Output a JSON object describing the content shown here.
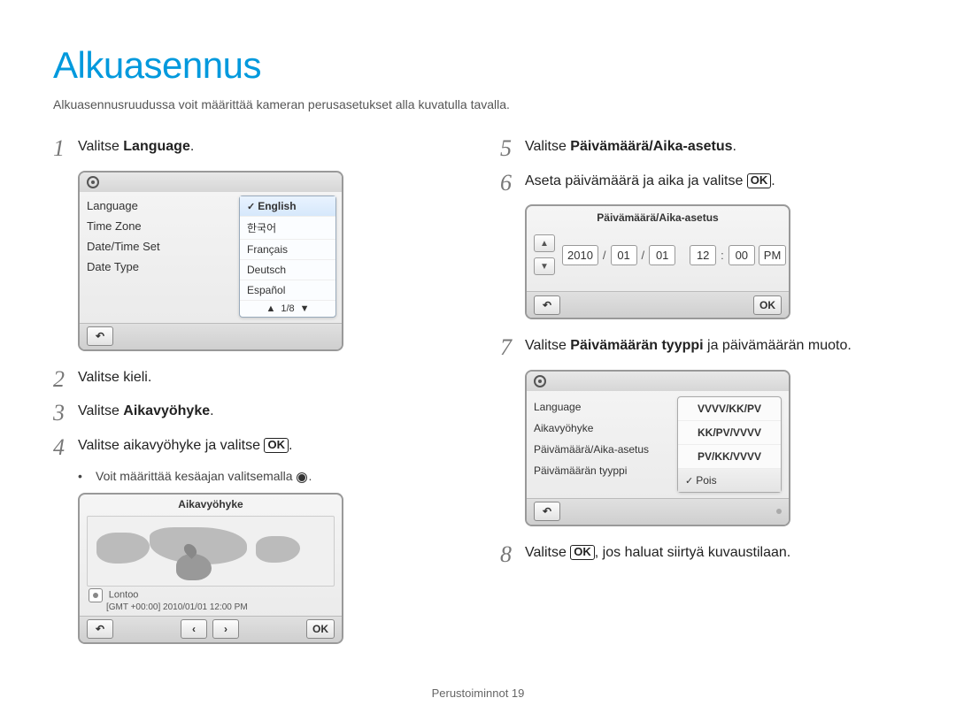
{
  "title": "Alkuasennus",
  "intro": "Alkuasennusruudussa voit määrittää kameran perusasetukset alla kuvatulla tavalla.",
  "steps": {
    "s1": {
      "num": "1",
      "prefix": "Valitse ",
      "bold": "Language",
      "suffix": "."
    },
    "s2": {
      "num": "2",
      "text": "Valitse kieli."
    },
    "s3": {
      "num": "3",
      "prefix": "Valitse ",
      "bold": "Aikavyöhyke",
      "suffix": "."
    },
    "s4": {
      "num": "4",
      "text_a": "Valitse aikavyöhyke ja valitse ",
      "text_b": "."
    },
    "s4_bullet": "Voit määrittää kesäajan valitsemalla ",
    "s5": {
      "num": "5",
      "prefix": "Valitse ",
      "bold": "Päivämäärä/Aika-asetus",
      "suffix": "."
    },
    "s6": {
      "num": "6",
      "text_a": "Aseta päivämäärä ja aika ja valitse ",
      "text_b": "."
    },
    "s7": {
      "num": "7",
      "prefix": "Valitse ",
      "bold": "Päivämäärän tyyppi",
      "suffix": " ja päivämäärän muoto."
    },
    "s8": {
      "num": "8",
      "text_a": "Valitse ",
      "text_b": ", jos haluat siirtyä kuvaustilaan."
    }
  },
  "lang_panel": {
    "menu": [
      "Language",
      "Time Zone",
      "Date/Time Set",
      "Date Type"
    ],
    "opts": [
      "English",
      "한국어",
      "Français",
      "Deutsch",
      "Español"
    ],
    "pager": "1/8"
  },
  "tz_panel": {
    "title": "Aikavyöhyke",
    "location": "Lontoo",
    "gmt_line": "[GMT +00:00]  2010/01/01  12:00 PM",
    "back": "↶",
    "left": "‹",
    "right": "›",
    "ok": "OK"
  },
  "dt_panel": {
    "title": "Päivämäärä/Aika-asetus",
    "year": "2010",
    "mon": "01",
    "day": "01",
    "hour": "12",
    "min": "00",
    "ampm": "PM",
    "slash": "/",
    "colon": ":",
    "back": "↶",
    "ok": "OK"
  },
  "dtype_panel": {
    "menu": [
      "Language",
      "Aikavyöhyke",
      "Päivämäärä/Aika-asetus",
      "Päivämäärän tyyppi"
    ],
    "opts": [
      "VVVV/KK/PV",
      "KK/PV/VVVV",
      "PV/KK/VVVV",
      "Pois"
    ],
    "back": "↶"
  },
  "ok_glyph": "OK",
  "footer": {
    "label": "Perustoiminnot ",
    "page": "19"
  }
}
